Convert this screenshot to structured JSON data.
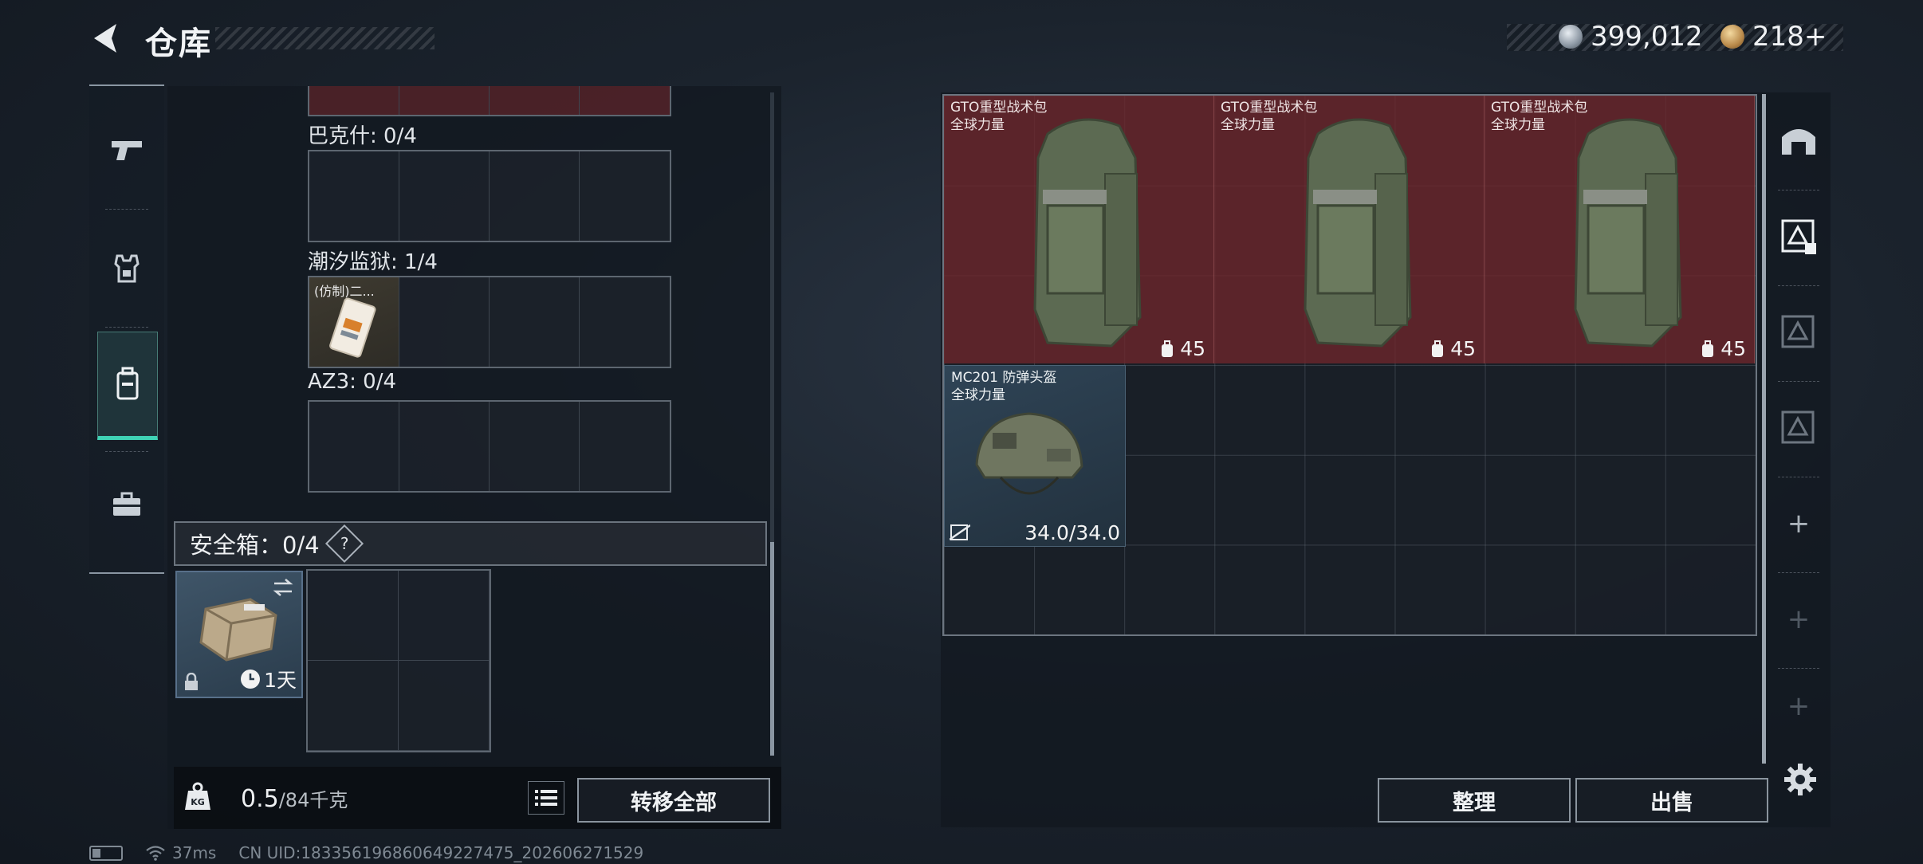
{
  "header": {
    "title": "仓库"
  },
  "currency": [
    {
      "value": "399,012",
      "icon": "silver-coin-icon"
    },
    {
      "value": "218+",
      "icon": "gold-coin-icon"
    }
  ],
  "left_nav": [
    {
      "name": "pistol",
      "icon": "pistol-icon"
    },
    {
      "name": "armor",
      "icon": "armor-vest-icon"
    },
    {
      "name": "backpack",
      "icon": "backpack-icon",
      "active": true
    },
    {
      "name": "toolbox",
      "icon": "toolbox-icon"
    }
  ],
  "inventory": {
    "sections": [
      {
        "label": "巴克什: 0/4",
        "filled": 0
      },
      {
        "label": "潮汐监狱: 1/4",
        "filled": 1,
        "item_label": "(仿制)二..."
      },
      {
        "label": "AZ3: 0/4",
        "filled": 0
      }
    ],
    "safebox": {
      "label": "安全箱：0/4",
      "help": "?",
      "timer": "1天"
    },
    "weight": {
      "current": "0.5",
      "max": "/84千克"
    },
    "transfer_all": "转移全部"
  },
  "stash": {
    "bags": [
      {
        "name": "GTO重型战术包",
        "sub": "全球力量",
        "capacity": "45"
      },
      {
        "name": "GTO重型战术包",
        "sub": "全球力量",
        "capacity": "45"
      },
      {
        "name": "GTO重型战术包",
        "sub": "全球力量",
        "capacity": "45"
      }
    ],
    "helmet": {
      "name": "MC201 防弹头盔",
      "sub": "全球力量",
      "durability": "34.0/34.0"
    },
    "grid": {
      "cols": 9,
      "rows": 6
    }
  },
  "right_nav": {
    "tabs": [
      "stash-home-icon",
      "stash-tab-1-icon",
      "stash-tab-2-icon",
      "stash-tab-3-icon"
    ],
    "plus": "+"
  },
  "actions": {
    "sort": "整理",
    "sell": "出售"
  },
  "status_bar": {
    "ping": "37ms",
    "uid": "CN UID:18335619686064922747​5_202606271529"
  },
  "colors": {
    "accent": "#3fd3b5",
    "bag_bg": "#6e262c",
    "helmet_bg": "#2f4456"
  }
}
